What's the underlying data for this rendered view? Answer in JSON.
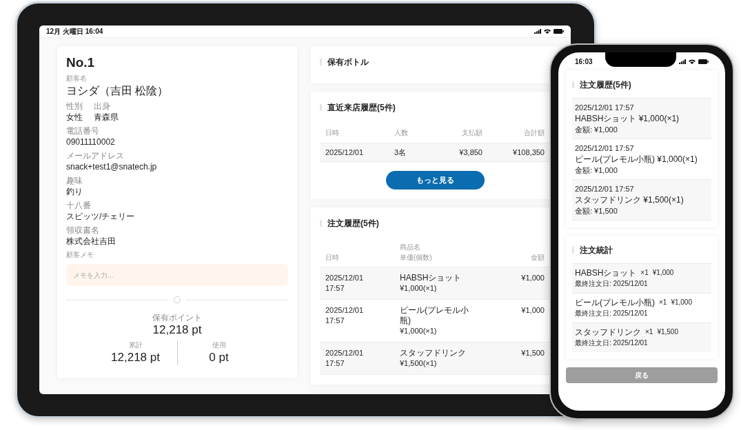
{
  "tablet": {
    "status_bar": {
      "time": "12月 火曜日 16:04"
    },
    "customer": {
      "number": "No.1",
      "name_label": "顧客名",
      "name": "ヨシダ（吉田 松陰）",
      "fields": [
        {
          "items": [
            {
              "label": "性別",
              "value": "女性"
            },
            {
              "label": "出身",
              "value": "青森県"
            }
          ]
        },
        {
          "items": [
            {
              "label": "電話番号",
              "value": "09011110002"
            }
          ]
        },
        {
          "items": [
            {
              "label": "メールアドレス",
              "value": "snack+test1@snatech.jp"
            }
          ]
        },
        {
          "items": [
            {
              "label": "趣味",
              "value": "釣り"
            }
          ]
        },
        {
          "items": [
            {
              "label": "十八番",
              "value": "スピッツ/チェリー"
            }
          ]
        },
        {
          "items": [
            {
              "label": "領収書名",
              "value": "株式会社吉田"
            }
          ]
        }
      ],
      "memo": {
        "label": "顧客メモ",
        "placeholder": "メモを入力..."
      },
      "points": {
        "label": "保有ポイント",
        "value": "12,218 pt",
        "total_label": "累計",
        "total": "12,218 pt",
        "used_label": "使用",
        "used": "0 pt"
      }
    },
    "bottles": {
      "title": "保有ボトル"
    },
    "visits": {
      "title": "直近来店履歴(5件)",
      "columns": [
        "日時",
        "人数",
        "支払額",
        "合計額"
      ],
      "rows": [
        {
          "date": "2025/12/01",
          "people": "3名",
          "paid": "¥3,850",
          "total": "¥108,350"
        }
      ],
      "more_button": "もっと見る"
    },
    "orders": {
      "title": "注文履歴(5件)",
      "columns": [
        [
          "日時"
        ],
        [
          "商品名",
          "単価(個数)"
        ],
        [
          "金額"
        ]
      ],
      "rows": [
        {
          "date": "2025/12/01",
          "time": "17:57",
          "product": "HABSHショット",
          "unit": "¥1,000(×1)",
          "amount": "¥1,000"
        },
        {
          "date": "2025/12/01",
          "time": "17:57",
          "product": "ビール(プレモル小瓶)",
          "unit": "¥1,000(×1)",
          "amount": "¥1,000"
        },
        {
          "date": "2025/12/01",
          "time": "17:57",
          "product": "スタッフドリンク",
          "unit": "¥1,500(×1)",
          "amount": "¥1,500"
        }
      ]
    }
  },
  "phone": {
    "status_bar": {
      "time": "16:03"
    },
    "orders": {
      "title": "注文履歴(5件)",
      "items": [
        {
          "datetime": "2025/12/01 17:57",
          "item": "HABSHショット ¥1,000(×1)",
          "amount": "金額: ¥1,000"
        },
        {
          "datetime": "2025/12/01 17:57",
          "item": "ビール(プレモル小瓶) ¥1,000(×1)",
          "amount": "金額: ¥1,000"
        },
        {
          "datetime": "2025/12/01 17:57",
          "item": "スタッフドリンク ¥1,500(×1)",
          "amount": "金額: ¥1,500"
        }
      ]
    },
    "stats": {
      "title": "注文統計",
      "items": [
        {
          "name": "HABSHショット",
          "qty": "×1",
          "price": "¥1,000",
          "last": "最終注文日: 2025/12/01"
        },
        {
          "name": "ビール(プレモル小瓶)",
          "qty": "×1",
          "price": "¥1,000",
          "last": "最終注文日: 2025/12/01"
        },
        {
          "name": "スタッフドリンク",
          "qty": "×1",
          "price": "¥1,500",
          "last": "最終注文日: 2025/12/01"
        }
      ]
    },
    "back_button": "戻る"
  }
}
